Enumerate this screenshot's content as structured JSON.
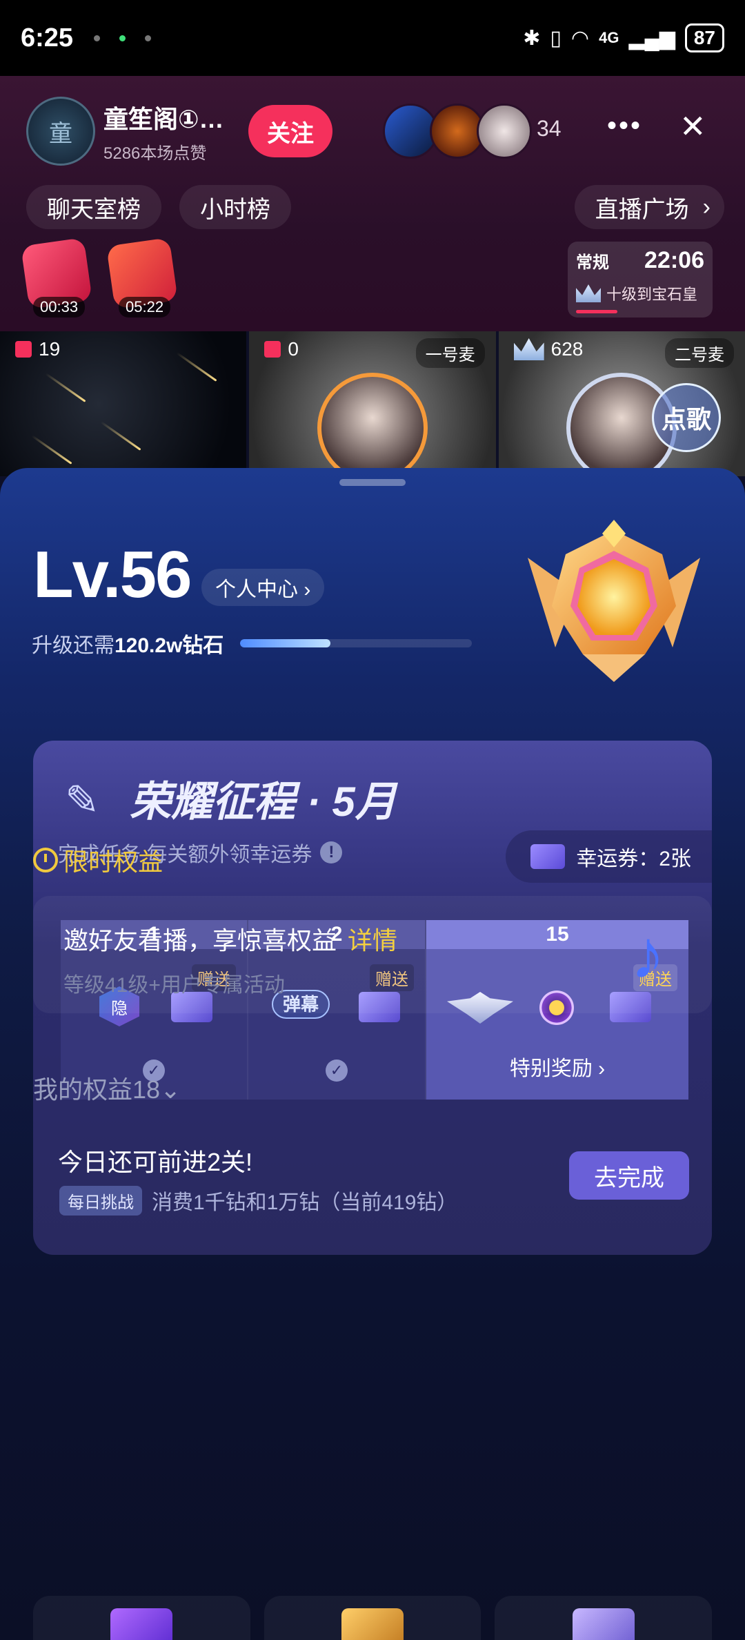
{
  "status_bar": {
    "time": "6:25",
    "network": "4G",
    "battery": "87"
  },
  "room": {
    "anchor_name": "童笙阁①…",
    "anchor_likes": "5286本场点赞",
    "avatar_text": "童",
    "follow_label": "关注",
    "viewer_count": "34",
    "more_label": "•••",
    "close_label": "✕",
    "rank_tabs": [
      "聊天室榜",
      "小时榜"
    ],
    "plaza_label": "直播广场",
    "gift_timers": [
      "00:33",
      "05:22"
    ],
    "mode_label": "常规",
    "mode_clock": "22:06",
    "mode_task": "十级到宝石皇"
  },
  "seats": [
    {
      "count": "19",
      "mic": ""
    },
    {
      "count": "0",
      "mic": "一号麦"
    },
    {
      "count": "628",
      "mic": "二号麦"
    }
  ],
  "song_button": "点歌",
  "level": {
    "title": "Lv.56",
    "center_link": "个人中心 ›",
    "upgrade_prefix": "升级还需",
    "upgrade_amount": "120.2w钻石",
    "progress": 0.39
  },
  "honor": {
    "title": "荣耀征程 · 5月",
    "subtitle": "完成任务,每关额外领幸运券",
    "ticket_label": "幸运券：2张",
    "steps": [
      {
        "num": "1",
        "give": "赠送",
        "badge": "隐"
      },
      {
        "num": "2",
        "give": "赠送",
        "badge": "弹幕"
      },
      {
        "num": "15",
        "give": "赠送",
        "special": "特别奖励 ›"
      }
    ],
    "today_text": "今日还可前进2关!",
    "daily_tag": "每日挑战",
    "daily_text": "消费1千钻和1万钻（当前419钻）",
    "go_button": "去完成"
  },
  "limited": {
    "title": "限时权益",
    "invite_title": "邀好友看播，享惊喜权益",
    "invite_detail": "详情",
    "invite_sub": "等级41级+用户专属活动"
  },
  "my_rights": "我的权益18⌄",
  "colors": {
    "accent_pink": "#f5305c",
    "gold": "#f0c93e",
    "purple_btn": "#6a60d8"
  }
}
